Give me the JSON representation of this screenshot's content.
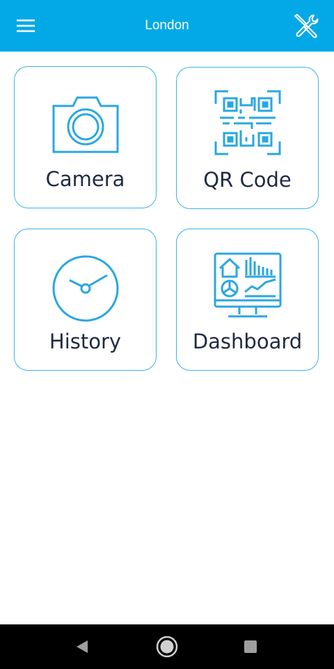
{
  "header": {
    "title": "London",
    "menu_icon": "hamburger-menu-icon",
    "tools_icon": "tools-icon"
  },
  "tiles": [
    {
      "label": "Camera",
      "icon": "camera-icon"
    },
    {
      "label": "QR Code",
      "icon": "qr-code-icon"
    },
    {
      "label": "History",
      "icon": "clock-icon"
    },
    {
      "label": "Dashboard",
      "icon": "dashboard-monitor-icon"
    }
  ],
  "navigation_bar": {
    "back_icon": "back-triangle-icon",
    "home_icon": "home-circle-icon",
    "recents_icon": "recents-square-icon"
  },
  "colors": {
    "accent": "#03a9e6",
    "icon_blue": "#2aa7e0",
    "label_text": "#1f2a44",
    "tile_border": "#3ab2e6"
  }
}
